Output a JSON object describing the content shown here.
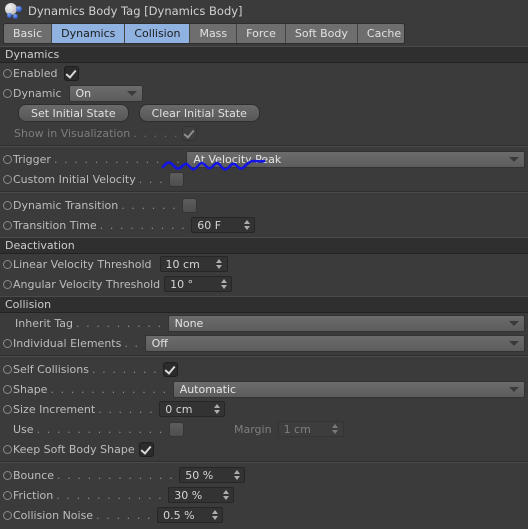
{
  "window": {
    "title": "Dynamics Body Tag [Dynamics Body]",
    "icon": "dynamics-body-tag-icon"
  },
  "tabs": [
    {
      "label": "Basic",
      "selected": false
    },
    {
      "label": "Dynamics",
      "selected": true
    },
    {
      "label": "Collision",
      "selected": true
    },
    {
      "label": "Mass",
      "selected": false
    },
    {
      "label": "Force",
      "selected": false
    },
    {
      "label": "Soft Body",
      "selected": false
    },
    {
      "label": "Cache",
      "selected": false
    }
  ],
  "sections": {
    "dynamics": {
      "header": "Dynamics",
      "enabled": {
        "label": "Enabled",
        "dots": "",
        "value": "checked"
      },
      "dynamic": {
        "label": "Dynamic",
        "dots": "",
        "value": "On"
      },
      "set_initial_state": "Set Initial State",
      "clear_initial_state": "Clear Initial State",
      "show_in_visualization": {
        "label": "Show in Visualization",
        "dots": ". . . . .",
        "value": "checked"
      },
      "trigger": {
        "label": "Trigger",
        "dots": ". . . . . . . . . . . . .",
        "value": "At Velocity Peak"
      },
      "custom_initial_velocity": {
        "label": "Custom Initial Velocity",
        "dots": ". . .",
        "value": "unchecked"
      },
      "dynamic_transition": {
        "label": "Dynamic Transition",
        "dots": ". . . . . .",
        "value": "unchecked"
      },
      "transition_time": {
        "label": "Transition Time",
        "dots": ". . . . . . . . .",
        "value": "60 F"
      }
    },
    "deactivation": {
      "header": "Deactivation",
      "linear_velocity_threshold": {
        "label": "Linear Velocity Threshold",
        "dots": "",
        "value": "10 cm"
      },
      "angular_velocity_threshold": {
        "label": "Angular Velocity Threshold",
        "dots": "",
        "value": "10 °"
      }
    },
    "collision": {
      "header": "Collision",
      "inherit_tag": {
        "label": "Inherit Tag",
        "dots": ". . . . . . . . .",
        "value": "None"
      },
      "individual_elements": {
        "label": "Individual Elements",
        "dots": ". .",
        "value": "Off"
      },
      "self_collisions": {
        "label": "Self Collisions",
        "dots": ". . . . . . .",
        "value": "checked"
      },
      "shape": {
        "label": "Shape",
        "dots": ". . . . . . . . . . . .",
        "value": "Automatic"
      },
      "size_increment": {
        "label": "Size Increment",
        "dots": ". . . . . .",
        "value": "0 cm"
      },
      "use": {
        "label": "Use",
        "dots": ". . . . . . . . . . . . .",
        "value": "unchecked"
      },
      "margin": {
        "label": "Margin",
        "value": "1 cm"
      },
      "keep_soft_body_shape": {
        "label": "Keep Soft Body Shape",
        "dots": "",
        "value": "checked"
      },
      "bounce": {
        "label": "Bounce",
        "dots": ". . . . . . . . . . . .",
        "value": "50 %"
      },
      "friction": {
        "label": "Friction",
        "dots": ". . . . . . . . . . .",
        "value": "30 %"
      },
      "collision_noise": {
        "label": "Collision Noise",
        "dots": ". . . . . .",
        "value": "0.5 %"
      }
    }
  },
  "annotation": {
    "name": "blue-scribble-underline",
    "color": "#1414e6",
    "target": "At Velocity Peak"
  }
}
